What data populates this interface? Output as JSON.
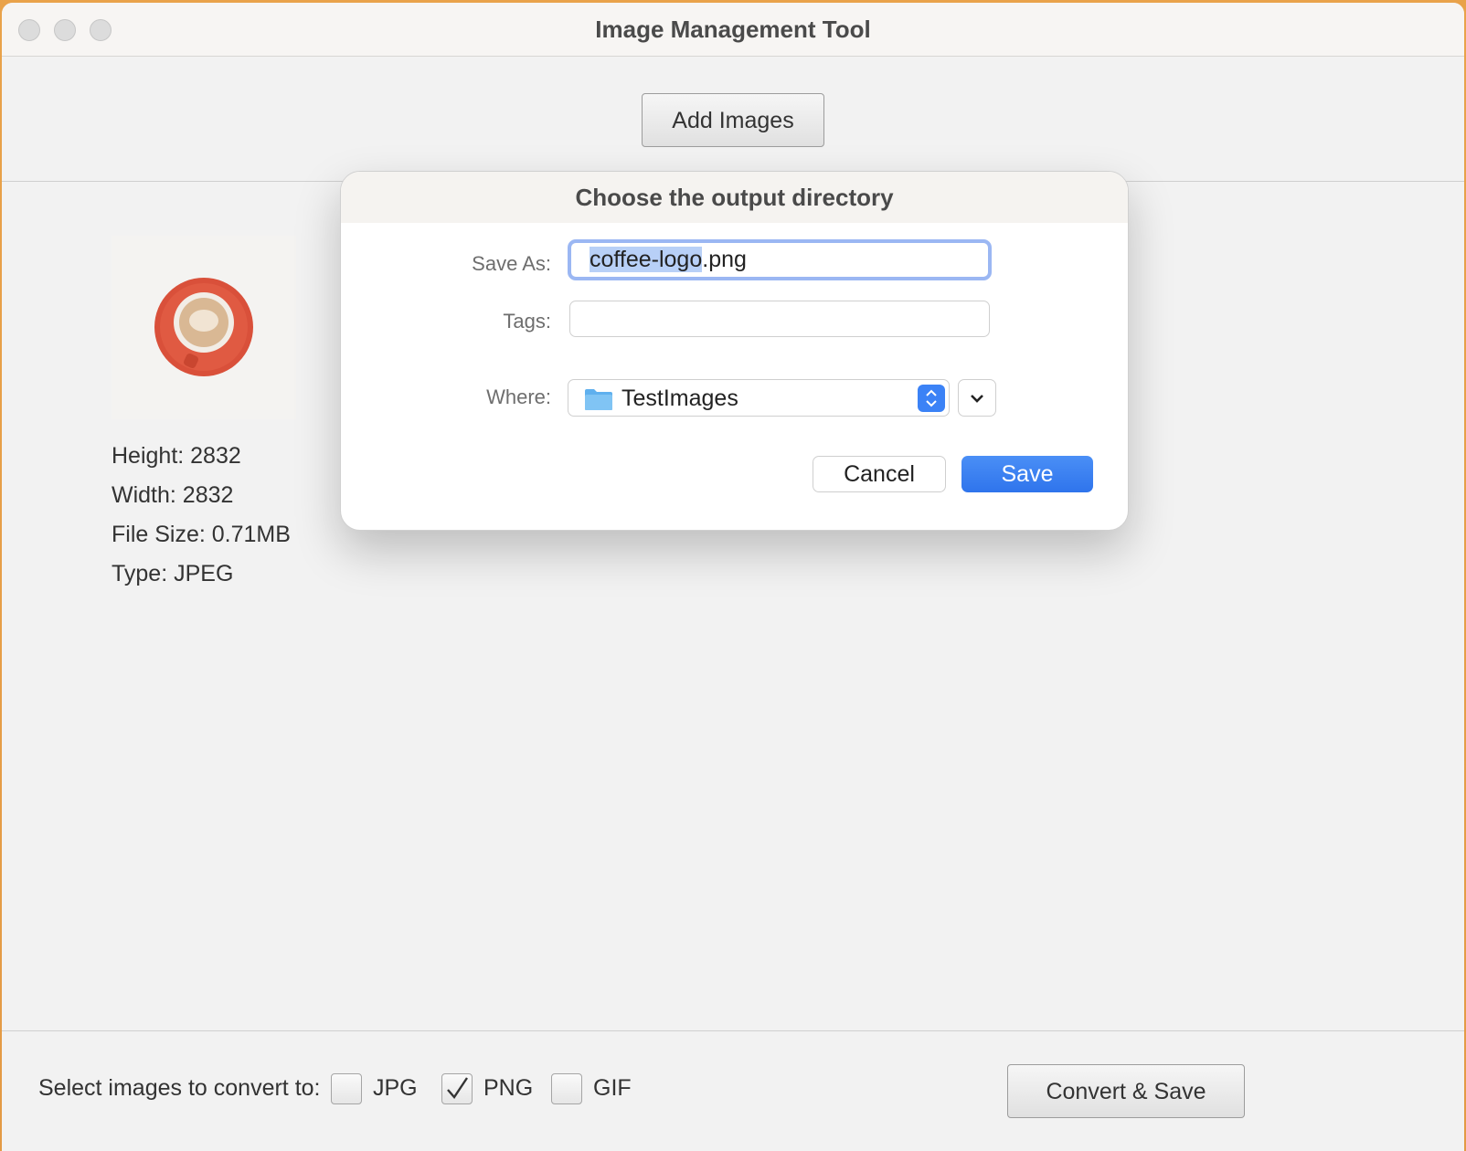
{
  "window": {
    "title": "Image Management Tool"
  },
  "toolbar": {
    "add_images_label": "Add Images"
  },
  "image_info": {
    "height": "Height: 2832",
    "width": "Width: 2832",
    "file_size": "File Size: 0.71MB",
    "type": "Type: JPEG"
  },
  "bottom": {
    "label": "Select images to convert to:",
    "formats": [
      {
        "label": "JPG",
        "checked": false
      },
      {
        "label": "PNG",
        "checked": true
      },
      {
        "label": "GIF",
        "checked": false
      }
    ],
    "convert_label": "Convert & Save"
  },
  "dialog": {
    "title": "Choose the output directory",
    "save_as_label": "Save As:",
    "save_as_selected": "coffee-logo",
    "save_as_rest": ".png",
    "tags_label": "Tags:",
    "tags_value": "",
    "where_label": "Where:",
    "where_value": "TestImages",
    "cancel_label": "Cancel",
    "save_label": "Save"
  },
  "colors": {
    "accent": "#3b82f6",
    "cup_red": "#d9503a"
  }
}
